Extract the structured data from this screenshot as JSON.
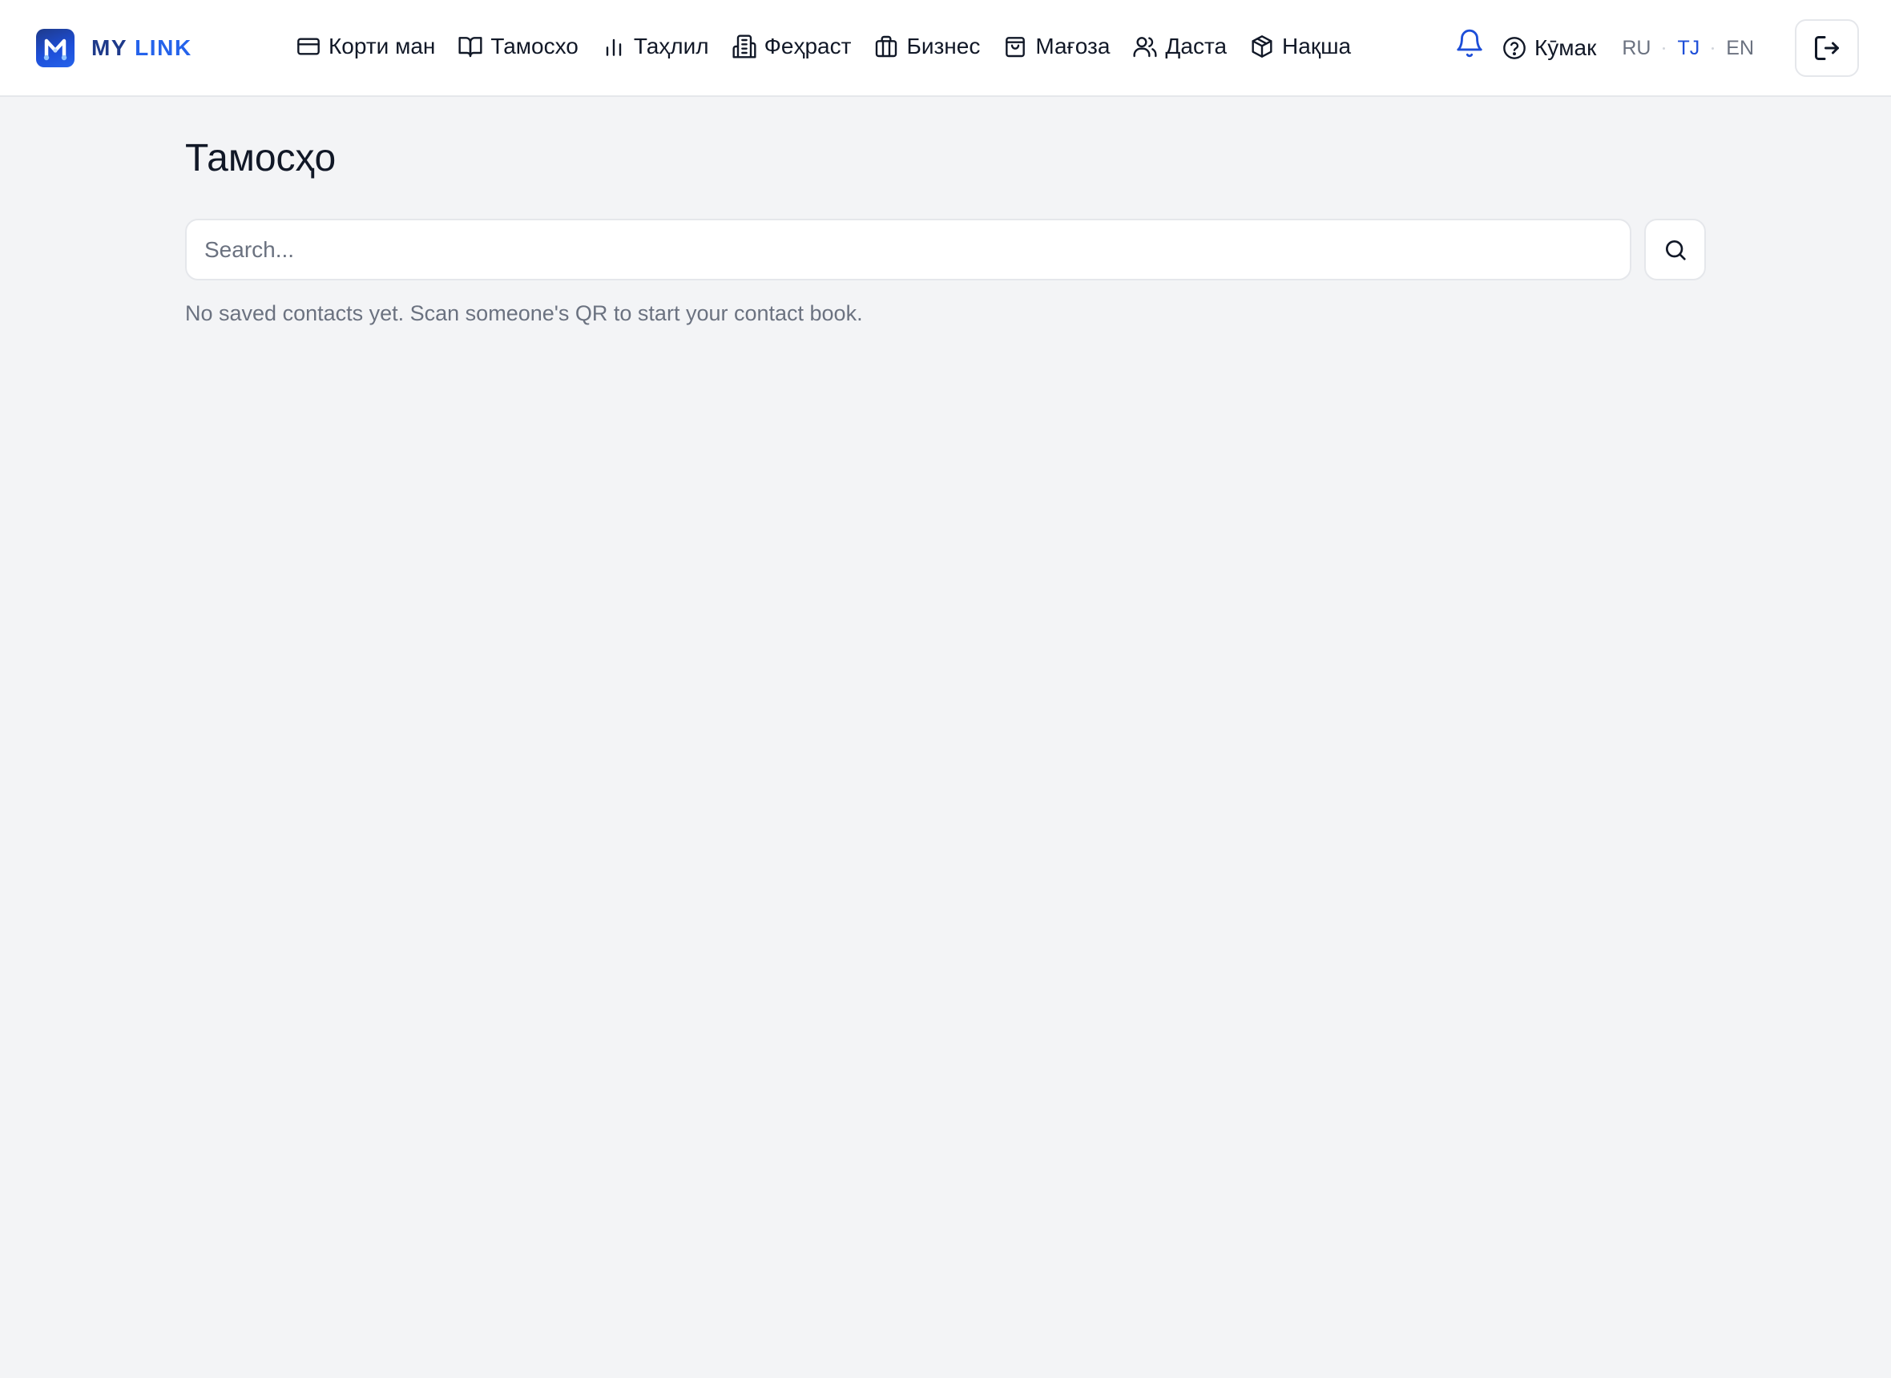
{
  "brand": {
    "name_part1": "MY ",
    "name_part2": "LINK",
    "icon": "m-logo-icon"
  },
  "nav": {
    "items": [
      {
        "label": "Корти ман",
        "icon": "card-icon"
      },
      {
        "label": "Тамосхо",
        "icon": "book-icon"
      },
      {
        "label": "Таҳлил",
        "icon": "bar-chart-icon"
      },
      {
        "label": "Феҳраст",
        "icon": "building-icon"
      },
      {
        "label": "Бизнес",
        "icon": "briefcase-icon"
      },
      {
        "label": "Мағоза",
        "icon": "shopping-bag-icon"
      },
      {
        "label": "Даста",
        "icon": "users-icon"
      },
      {
        "label": "Нақша",
        "icon": "package-icon"
      }
    ]
  },
  "header_right": {
    "help_label": "Кӯмак",
    "languages": [
      "RU",
      "TJ",
      "EN"
    ],
    "active_language": "TJ"
  },
  "main": {
    "title": "Тамосҳо",
    "search": {
      "placeholder": "Search...",
      "value": ""
    },
    "empty_message": "No saved contacts yet. Scan someone's QR to start your contact book."
  },
  "colors": {
    "accent": "#1d4ed8",
    "brand_dark": "#1e3a8a",
    "background": "#f3f4f6",
    "muted_text": "#6b7280"
  }
}
